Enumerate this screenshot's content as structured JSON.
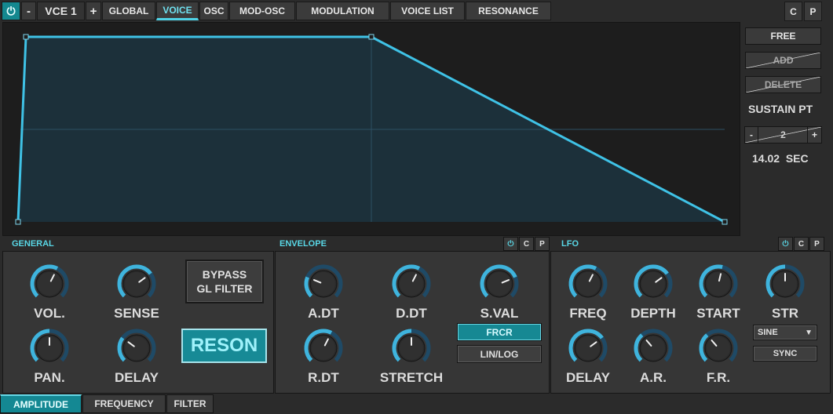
{
  "top_bar": {
    "power_icon": "power-icon",
    "minus": "-",
    "voice_name": "VCE 1",
    "plus": "+",
    "tabs": [
      "GLOBAL",
      "VOICE",
      "OSC",
      "MOD-OSC",
      "MODULATION",
      "VOICE LIST",
      "RESONANCE"
    ],
    "active_tab": "VOICE",
    "copy": "C",
    "paste": "P"
  },
  "envelope_graph": {
    "line_color": "#3fc2e6",
    "fill_color": "#1c3440"
  },
  "side_panel": {
    "free": "FREE",
    "add": "ADD",
    "delete": "DELETE",
    "sustain_label": "SUSTAIN PT",
    "sustain_minus": "-",
    "sustain_value": "2",
    "sustain_plus": "+",
    "time_value": "14.02",
    "time_unit": "SEC"
  },
  "general": {
    "title": "GENERAL",
    "knobs": [
      {
        "label": "VOL.",
        "value": 0.6
      },
      {
        "label": "SENSE",
        "value": 0.7
      },
      {
        "label": "PAN.",
        "value": 0.5
      },
      {
        "label": "DELAY",
        "value": 0.3
      }
    ],
    "bypass_line1": "BYPASS",
    "bypass_line2": "GL FILTER",
    "reson": "RESON"
  },
  "envelope": {
    "title": "ENVELOPE",
    "power": "⏻",
    "copy": "C",
    "paste": "P",
    "knobs": [
      {
        "label": "A.DT",
        "value": 0.25
      },
      {
        "label": "D.DT",
        "value": 0.6
      },
      {
        "label": "S.VAL",
        "value": 0.75
      },
      {
        "label": "R.DT",
        "value": 0.6
      },
      {
        "label": "STRETCH",
        "value": 0.5
      }
    ],
    "frcr": "FRCR",
    "linlog": "LIN/LOG"
  },
  "lfo": {
    "title": "LFO",
    "power": "⏻",
    "copy": "C",
    "paste": "P",
    "knobs": [
      {
        "label": "FREQ",
        "value": 0.6
      },
      {
        "label": "DEPTH",
        "value": 0.7
      },
      {
        "label": "START",
        "value": 0.55
      },
      {
        "label": "STR",
        "value": 0.5
      },
      {
        "label": "DELAY",
        "value": 0.7
      },
      {
        "label": "A.R.",
        "value": 0.35
      },
      {
        "label": "F.R.",
        "value": 0.35
      }
    ],
    "wave": "SINE",
    "sync": "SYNC"
  },
  "bottom_tabs": {
    "tabs": [
      "AMPLITUDE",
      "FREQUENCY",
      "FILTER"
    ],
    "active": "AMPLITUDE"
  },
  "colors": {
    "accent": "#4fd2e6",
    "knob_ring": "#3fb4dd",
    "knob_track": "#1f4a66",
    "active_button": "#168893"
  }
}
